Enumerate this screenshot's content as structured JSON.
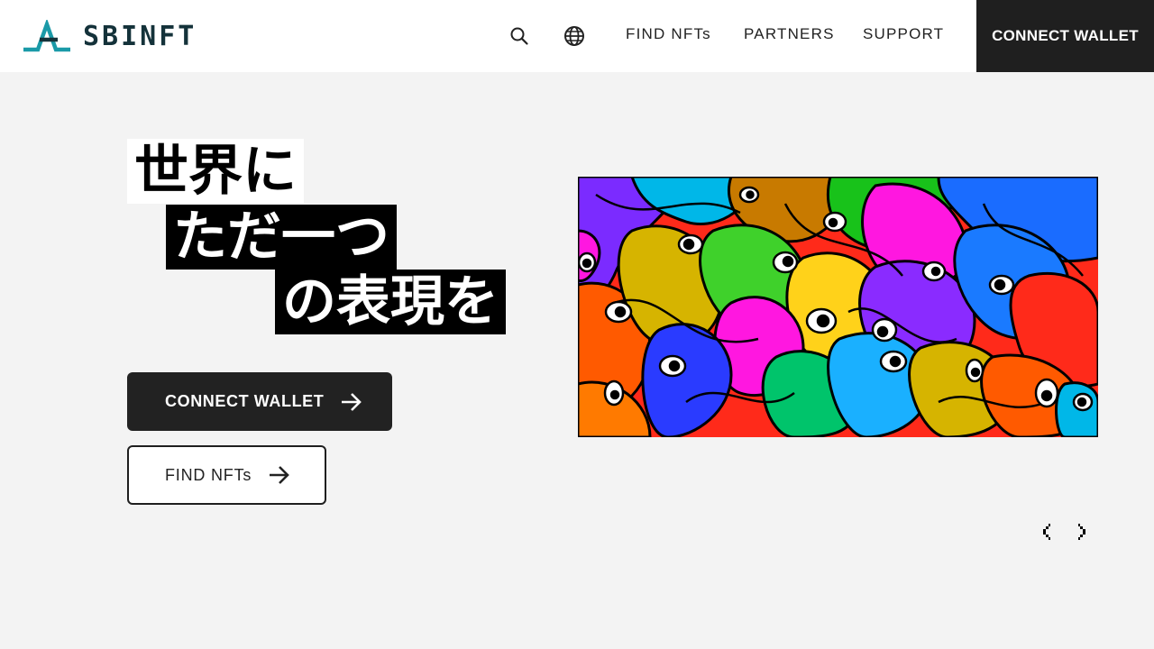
{
  "brand": {
    "name": "SBINFT",
    "logo_icon": "sbinft-logo-mark",
    "logo_color": "#14323a",
    "logo_accent": "#1a9aa8"
  },
  "header": {
    "search_icon": "search-icon",
    "language_icon": "globe-icon",
    "nav": [
      {
        "label": "FIND NFTs"
      },
      {
        "label": "PARTNERS"
      },
      {
        "label": "SUPPORT"
      }
    ],
    "cta_label": "CONNECT WALLET"
  },
  "hero": {
    "lines": [
      "世界に",
      "ただ一つ",
      "の表現を"
    ],
    "primary_button": {
      "label": "CONNECT WALLET",
      "icon": "arrow-right-icon"
    },
    "secondary_button": {
      "label": "FIND NFTs",
      "icon": "arrow-right-icon"
    }
  },
  "carousel": {
    "prev_icon": "chevron-left-icon",
    "next_icon": "chevron-right-icon"
  },
  "colors": {
    "background": "#f3f3f3",
    "header_bg": "#ffffff",
    "dark": "#1f1f1f",
    "text": "#222222"
  }
}
